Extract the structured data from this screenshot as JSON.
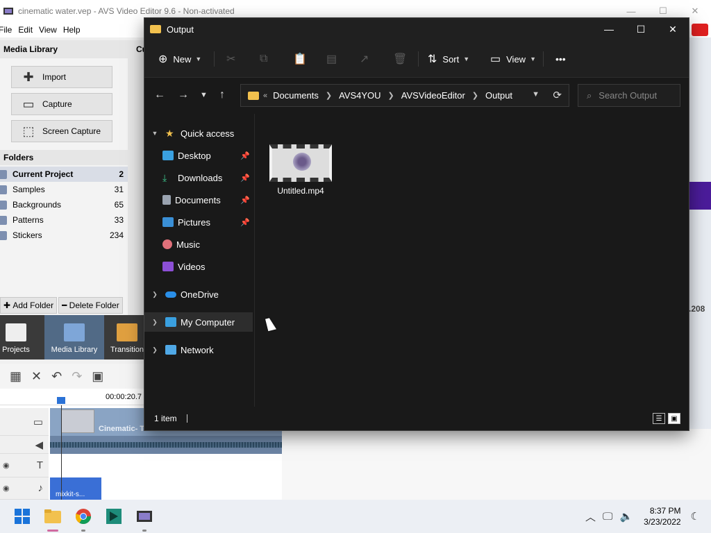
{
  "avs": {
    "title": "cinematic water.vep - AVS Video Editor 9.6 - Non-activated",
    "menu": [
      "File",
      "Edit",
      "View",
      "Help"
    ],
    "media_library_header": "Media Library",
    "cut_label": "Cu",
    "buttons": {
      "import": "Import",
      "capture": "Capture",
      "screen_capture": "Screen Capture"
    },
    "folders_header": "Folders",
    "folders": [
      {
        "name": "Current Project",
        "count": "2"
      },
      {
        "name": "Samples",
        "count": "31"
      },
      {
        "name": "Backgrounds",
        "count": "65"
      },
      {
        "name": "Patterns",
        "count": "33"
      },
      {
        "name": "Stickers",
        "count": "234"
      }
    ],
    "add_folder": "Add Folder",
    "delete_folder": "Delete Folder",
    "ribbon": {
      "projects": "Projects",
      "media_library": "Media Library",
      "transitions": "Transition"
    },
    "timeline": {
      "time": "00:00:20.7",
      "video_clip_caption": "Cinematic- Theme - Preview",
      "music_clip_caption": "mixkit-s..."
    },
    "right_value": ".208"
  },
  "explorer": {
    "title": "Output",
    "toolbar": {
      "new": "New",
      "sort": "Sort",
      "view": "View",
      "more": "•••"
    },
    "breadcrumb": [
      "Documents",
      "AVS4YOU",
      "AVSVideoEditor",
      "Output"
    ],
    "breadcrumb_prefix": "«",
    "search_placeholder": "Search Output",
    "nav": {
      "quick_access": "Quick access",
      "desktop": "Desktop",
      "downloads": "Downloads",
      "documents": "Documents",
      "pictures": "Pictures",
      "music": "Music",
      "videos": "Videos",
      "onedrive": "OneDrive",
      "my_computer": "My Computer",
      "network": "Network"
    },
    "files": [
      {
        "name": "Untitled.mp4"
      }
    ],
    "status": {
      "count": "1 item"
    }
  },
  "taskbar": {
    "time": "8:37 PM",
    "date": "3/23/2022"
  },
  "colors": {
    "accent": "#1a73d9",
    "folder": "#f2c14e",
    "explorer_bg": "#191919"
  }
}
